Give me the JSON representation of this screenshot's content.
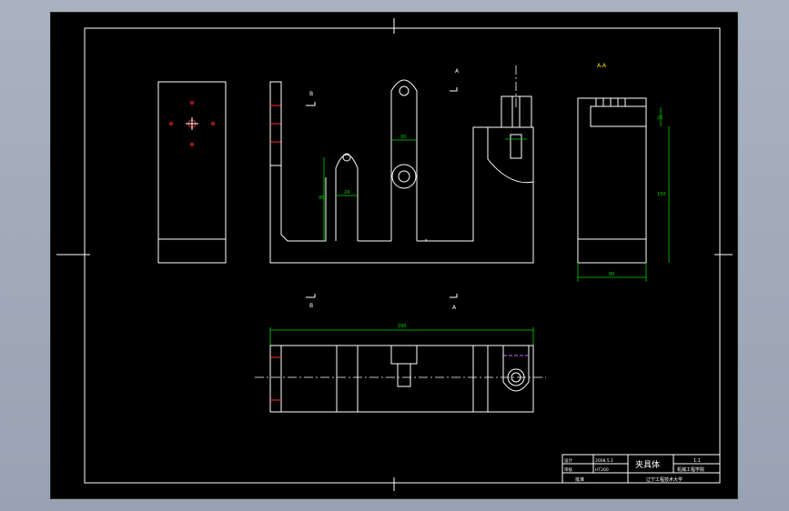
{
  "drawing": {
    "front": {
      "dim_height": "95",
      "dim_lug": "24",
      "dim_arm": "30",
      "mark_a": "A",
      "mark_b": "B",
      "view_label": "A-A"
    },
    "side": {
      "dim_top": "20",
      "dim_height": "150",
      "dim_width": "80"
    },
    "plan": {
      "dim_length": "290"
    }
  },
  "title_block": {
    "drawn": "设计",
    "date": "2008.5.1",
    "checked": "审核",
    "material": "HT200",
    "approved": "批准",
    "part_name": "夹具体",
    "scale": "1:1",
    "drawing_no": "机械工程学院",
    "school": "辽宁工程技术大学",
    "colors": {
      "background": "#000000",
      "lines": "#ffffff",
      "dimensions": "#00d400",
      "centers": "#ff2a2a"
    }
  }
}
